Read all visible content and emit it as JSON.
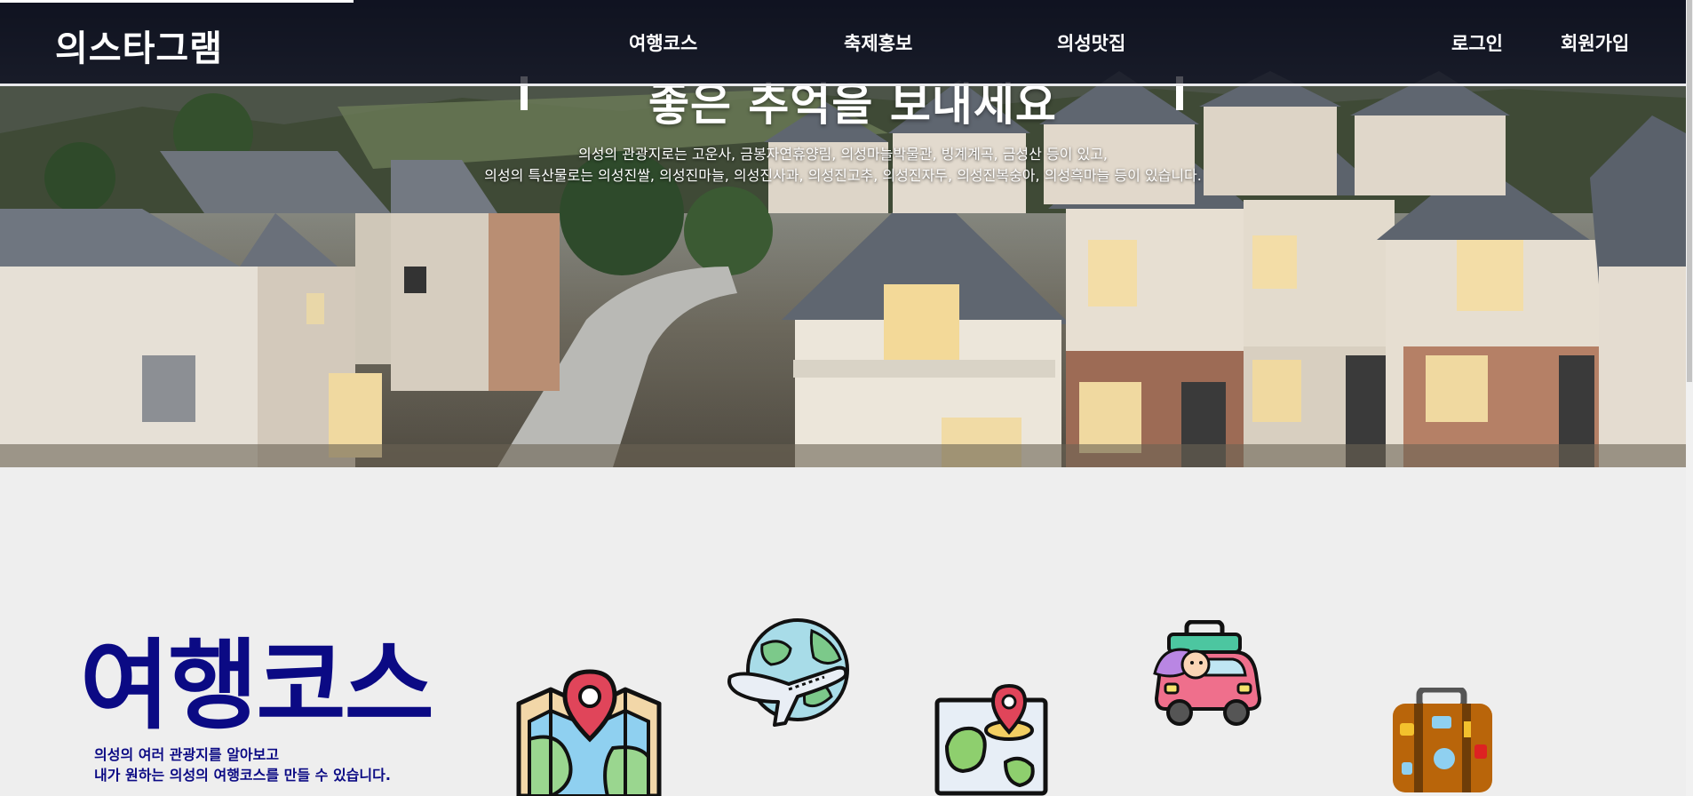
{
  "header": {
    "logo": "의스타그램",
    "nav": [
      "여행코스",
      "축제홍보",
      "의성맛집"
    ],
    "login": "로그인",
    "signup": "회원가입"
  },
  "hero": {
    "title": "좋은 추억을 보내세요",
    "desc_line1": "의성의 관광지로는 고운사, 금봉자연휴양림, 의성마늘박물관, 빙계계곡, 금성산 등이 있고,",
    "desc_line2": "의성의 특산물로는 의성진쌀, 의성진마늘, 의성진사과, 의성진고추, 의성진자두, 의성진복숭아, 의성흑마늘 등이 있습니다."
  },
  "course": {
    "title": "여행코스",
    "desc_line1": "의성의 여러 관광지를 알아보고",
    "desc_line2": "내가 원하는 의성의 여행코스를 만들 수 있습니다."
  },
  "icons": [
    "map-icon",
    "globe-plane-icon",
    "map-pin-icon",
    "car-traveler-icon",
    "suitcase-icon"
  ],
  "colors": {
    "course_blue": "#0b0a84",
    "header_bg": "#080a16"
  }
}
